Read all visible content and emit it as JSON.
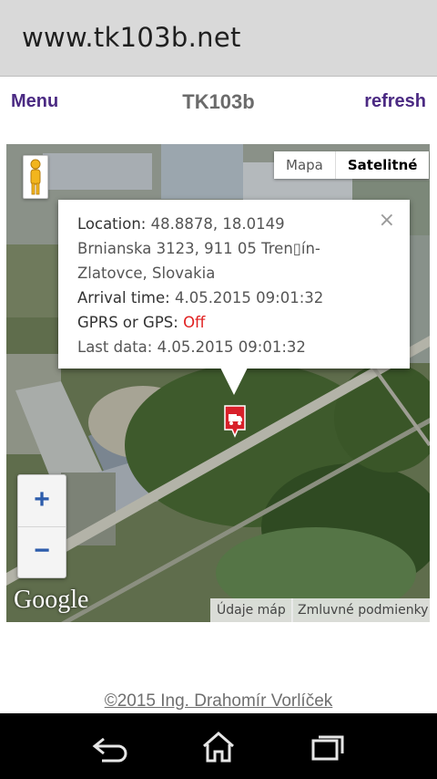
{
  "browser": {
    "url": "www.tk103b.net"
  },
  "header": {
    "menu_label": "Menu",
    "title": "TK103b",
    "refresh_label": "refresh"
  },
  "map": {
    "type_buttons": {
      "map": "Mapa",
      "satellite": "Satelitné"
    },
    "selected_type": "Satelitné",
    "zoom_in": "+",
    "zoom_out": "−",
    "logo": "Google",
    "footer_data": "Údaje máp",
    "footer_terms": "Zmluvné podmienky",
    "info": {
      "location_label": "Location:",
      "location_value": "48.8878, 18.0149",
      "address_line1": "Brnianska 3123, 911 05 Tren▯ín-",
      "address_line2": "Zlatovce, Slovakia",
      "arrival_label": "Arrival time:",
      "arrival_value": "4.05.2015 09:01:32",
      "gprs_label": "GPRS or GPS:",
      "gprs_value": "Off",
      "last_data": "Last data: 4.05.2015 09:01:32",
      "close": "×"
    },
    "marker_icon": "truck-icon"
  },
  "footer": {
    "copyright": "©2015 Ing. Drahomír Vorlíček"
  },
  "nav": {
    "icons": [
      "back-icon",
      "home-icon",
      "recent-apps-icon"
    ]
  },
  "colors": {
    "link": "#4b2a83",
    "off": "#e02020",
    "marker": "#d8202a"
  }
}
